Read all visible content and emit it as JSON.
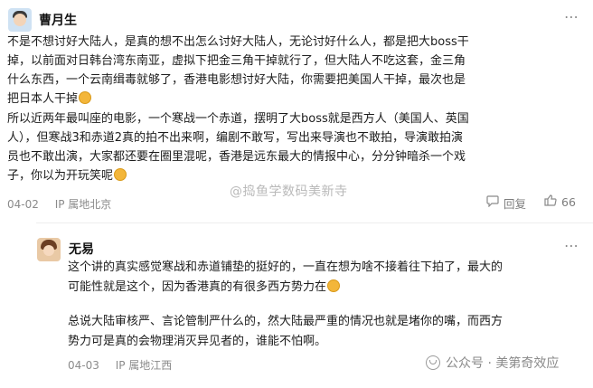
{
  "comment1": {
    "author": "曹月生",
    "lines": [
      "不是不想讨好大陆人，是真的想不出怎么讨好大陆人，无论讨好什么人，都是把大boss干",
      "掉，以前面对日韩台湾东南亚，虚拟下把金三角干掉就行了，但大陆人不吃这套，金三角",
      "什么东西，一个云南缉毒就够了，香港电影想讨好大陆，你需要把美国人干掉，最次也是",
      "把日本人干掉",
      "所以近两年最叫座的电影，一个寒战一个赤道，摆明了大boss就是西方人（美国人、英国",
      "人），但寒战3和赤道2真的拍不出来啊，编剧不敢写，写出来导演也不敢拍，导演敢拍演",
      "员也不敢出演，大家都还要在圈里混呢，香港是远东最大的情报中心，分分钟暗杀一个戏",
      "子，你以为开玩笑呢"
    ],
    "date": "04-02",
    "ip": "IP 属地北京",
    "reply_label": "回复",
    "like_count": "66"
  },
  "comment2": {
    "author": "无易",
    "lines": [
      "这个讲的真实感觉寒战和赤道铺垫的挺好的，一直在想为啥不接着往下拍了，最大的",
      "可能性就是这个，因为香港真的有很多西方势力在",
      "",
      "总说大陆审核严、言论管制严什么的，然大陆最严重的情况也就是堵你的嘴，而西方",
      "势力可是真的会物理消灭异见者的，谁能不怕啊。"
    ],
    "date": "04-03",
    "ip": "IP 属地江西"
  },
  "watermark": "@捣鱼学数码美新寺",
  "footer_watermark": "公众号 · 美第奇效应",
  "icons": {
    "more": "more-icon",
    "reply": "chat-bubble-icon",
    "like": "thumbs-up-icon",
    "emoji": "smile-emoji-icon",
    "wechat": "wechat-icon"
  }
}
